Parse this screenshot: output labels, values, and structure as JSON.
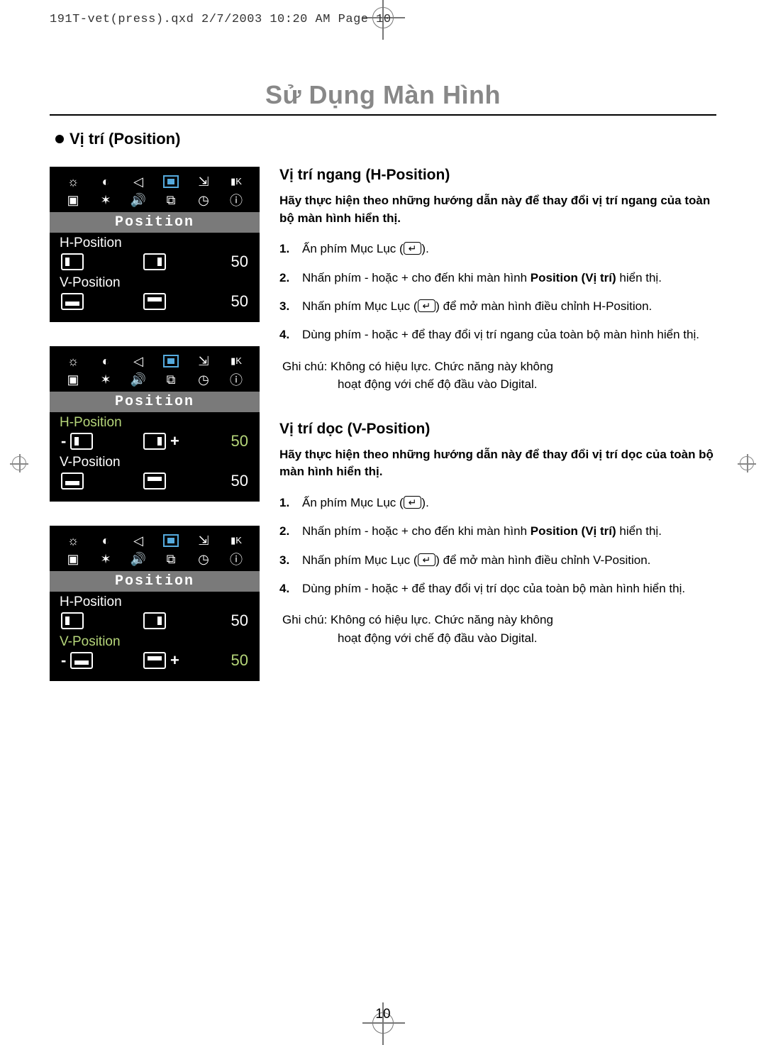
{
  "meta_header": "191T-vet(press).qxd  2/7/2003  10:20 AM  Page 10",
  "page_title": "Sử Dụng Màn Hình",
  "section_heading": "Vị trí (Position)",
  "osd": {
    "menu_label": "Position",
    "h_label": "H-Position",
    "v_label": "V-Position",
    "value_h": "50",
    "value_v": "50",
    "minus": "-",
    "plus": "+"
  },
  "h_section": {
    "heading": "Vị trí ngang (H-Position)",
    "intro": "Hãy thực hiện theo những hướng dẫn này để thay đổi vị trí ngang của toàn bộ màn hình hiển thị.",
    "steps": [
      {
        "pre": "Ấn phím Mục Lục (",
        "key": "↵",
        "post": ")."
      },
      {
        "pre": "Nhấn phím - hoặc + cho đến khi màn hình ",
        "bold": "Position (Vị trí)",
        "post": " hiển thị."
      },
      {
        "pre": "Nhấn phím Mục Lục (",
        "key": "↵",
        "post": ") để mở màn hình điều chỉnh H-Position."
      },
      {
        "pre": "Dùng phím - hoặc + để thay đổi vị trí ngang của toàn bộ màn hình hiển thị."
      }
    ],
    "note_label": "Ghi chú:",
    "note_line1": "Không có hiệu lực. Chức năng này không",
    "note_line2": "hoạt động với chế độ đầu vào Digital."
  },
  "v_section": {
    "heading": "Vị trí dọc (V-Position)",
    "intro": "Hãy thực hiện theo những hướng dẫn này để thay đổi vị trí dọc của toàn bộ màn hình hiển thị.",
    "steps": [
      {
        "pre": "Ấn phím Mục Lục (",
        "key": "↵",
        "post": ")."
      },
      {
        "pre": "Nhấn phím - hoặc + cho đến khi màn hình ",
        "bold": "Position (Vị trí)",
        "post": " hiển thị."
      },
      {
        "pre": "Nhấn phím Mục Lục (",
        "key": "↵",
        "post": ") để mở màn hình điều chỉnh V-Position."
      },
      {
        "pre": "Dùng phím - hoặc + để thay đổi vị trí dọc của toàn bộ màn hình hiển thị."
      }
    ],
    "note_label": "Ghi chú:",
    "note_line1": "Không có hiệu lực. Chức năng này không",
    "note_line2": "hoạt động với chế độ đầu vào Digital."
  },
  "page_number": "10"
}
